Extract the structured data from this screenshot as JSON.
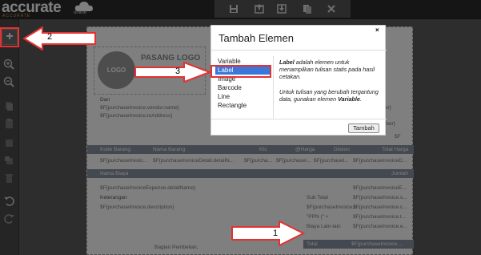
{
  "app": {
    "logo_text": "accurate",
    "logo_sub": "ACCURATE",
    "logo_online": "online"
  },
  "toolbar": {
    "icons": [
      "save-icon",
      "export-icon",
      "import-icon",
      "copy-icon",
      "close-icon"
    ]
  },
  "sidebar": {
    "icons": [
      "add-icon",
      "zoom-in-icon",
      "zoom-out-icon",
      "copy-icon",
      "paste-icon",
      "bring-front-icon",
      "send-back-icon",
      "delete-icon",
      "undo-icon",
      "redo-icon"
    ]
  },
  "report": {
    "logo_label": "LOGO",
    "pasang_logo": "PASANG LOGO",
    "dari_label": "Dari",
    "vendor_name": "$F{purchaseInvoice.vendor.name}",
    "vendor_address": "$F{purchaseInvoice.toAddress}",
    "right_number": "er}",
    "right_tail": "mber}",
    "right_dollar": "$F",
    "item_headers": [
      "Kode Barang",
      "Nama Barang",
      "Kts",
      "@Harga",
      "Diskon",
      "Total Harga"
    ],
    "item_row": [
      "$F{purchaseInvoic...",
      "$F{purchaseInvoiceDetail.detailN...",
      "$F{purcha...",
      "$F{purchaseI...",
      "$F{purchaseI...",
      "$F{purchaseInvoiceD..."
    ],
    "biaya_headers": [
      "Nama Biaya",
      "Jumlah"
    ],
    "biaya_row": [
      "$F{purchaseInvoiceExpense.detailName}",
      "$F{purchaseInvoiceE..."
    ],
    "keterangan_label": "Keterangan",
    "keterangan_value": "$F{purchaseInvoice.description}",
    "summary_labels": [
      "Sub Total",
      "$F{purchaseInvoice.c...",
      "\"PPN (\" +",
      "Biaya Lain-lain"
    ],
    "summary_values": [
      "$F{purchaseInvoice.s...",
      "$F{purchaseInvoice.c...",
      "$F{purchaseInvoice.t...",
      "$F{purchaseInvoice.e..."
    ],
    "total_label": "Total",
    "total_value": "$F{purchaseInvoice....",
    "bagian_pembelian": "Bagian Pembelian,"
  },
  "modal": {
    "title": "Tambah Elemen",
    "close": "×",
    "items": [
      "Variable",
      "Label",
      "Image",
      "Barcode",
      "Line",
      "Rectangle"
    ],
    "selected": "Label",
    "desc1_bold": "Label",
    "desc1_rest": " adalah elemen untuk menampilkan tulisan statis pada hasil cetakan.",
    "desc2_rest": "Untuk tulisan yang berubah tergantung data, gunakan elemen ",
    "desc2_bold": "Variable",
    "desc2_end": ".",
    "button": "Tambah"
  },
  "callouts": {
    "n1": "1",
    "n2": "2",
    "n3": "3"
  }
}
